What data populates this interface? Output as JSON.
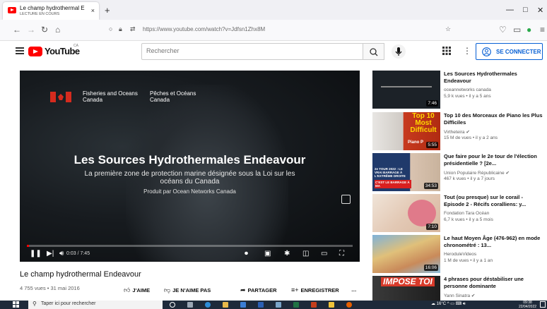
{
  "browser": {
    "tab_title": "Le champ hydrothermal Endea",
    "tab_status": "LECTURE EN COURS",
    "new_tab": "+",
    "close_tab": "×",
    "url": "https://www.youtube.com/watch?v=Jdfsn1Zhx8M",
    "win_min": "—",
    "win_max": "□",
    "win_close": "✕"
  },
  "youtube": {
    "logo_text": "YouTube",
    "country": "CA",
    "search_placeholder": "Rechercher",
    "signin": "SE CONNECTER"
  },
  "player": {
    "org_en": "Fisheries and Oceans\nCanada",
    "org_fr": "Pêches et Océans\nCanada",
    "title": "Les Sources Hydrothermales Endeavour",
    "subtitle": "La première zone de protection marine désignée sous la Loi sur les océans du Canada",
    "produced_by": "Produit par Ocean Networks Canada",
    "time": "0:03 / 7:45",
    "progress": 0.006
  },
  "video": {
    "title": "Le champ hydrothermal Endeavour",
    "meta": "4 755 vues • 31 mai 2016",
    "like": "J'AIME",
    "dislike": "JE N'AIME PAS",
    "share": "PARTAGER",
    "save": "ENREGISTRER",
    "more": "…"
  },
  "recommendations": [
    {
      "title": "Les Sources Hydrothermales Endeavour",
      "channel": "oceannetworks canada",
      "meta": "5,9 k vues • il y a 5 ans",
      "duration": "7:46",
      "thumb_color": "#1c2228"
    },
    {
      "title": "Top 10 des Morceaux de Piano les Plus Difficiles",
      "channel": "Virtheteira ✔",
      "meta": "15 M de vues • il y a 2 ans",
      "duration": "5:55",
      "thumb_text": "Top 10 Most Difficult",
      "thumb_sub": "Piano P",
      "thumb_color": "#c73a1e"
    },
    {
      "title": "Que faire pour le 2e tour de l'élection présidentielle ? [2e...",
      "channel": "Union Populaire Républicaine ✔",
      "meta": "467 k vues • il y a 7 jours",
      "duration": "34:53",
      "thumb_text": "2e TOUR 2022 : LE VRAI BARRAGE À L'EXTRÊME DROITE",
      "thumb_sub": "C'EST LE BARRAGE À MA",
      "thumb_color": "#203a6b"
    },
    {
      "title": "Tout (ou presque) sur le corail - Episode 2 - Récifs coralliens: y...",
      "channel": "Fondation Tara Océan",
      "meta": "6,7 k vues • il y a 5 mois",
      "duration": "7:10",
      "thumb_color": "#e8d7c8"
    },
    {
      "title": "Le haut Moyen Âge (476-962) en mode chronométré : 13...",
      "channel": "HeroduleVideos",
      "meta": "1 M de vues • il y a 1 an",
      "duration": "16:06",
      "thumb_color": "#6a9fc8"
    },
    {
      "title": "4 phrases pour déstabiliser une personne dominante",
      "channel": "Yann Sinatra ✔",
      "meta": "",
      "duration": "",
      "thumb_text": "IMPOSE TOI",
      "thumb_color": "#2a2a2a"
    }
  ],
  "taskbar": {
    "search_placeholder": "Taper ici pour rechercher",
    "weather": "16°C",
    "time": "09:38",
    "date": "22/04/2022"
  }
}
